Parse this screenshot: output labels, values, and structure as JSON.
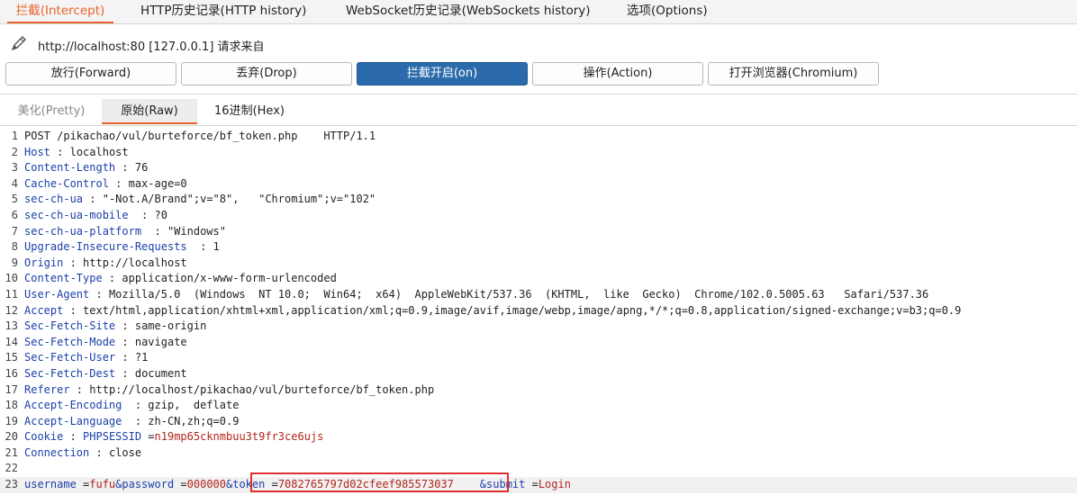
{
  "top_tabs": [
    {
      "label": "拦截(Intercept)",
      "active": true
    },
    {
      "label": "HTTP历史记录(HTTP history)"
    },
    {
      "label": "WebSocket历史记录(WebSockets history)"
    },
    {
      "label": "选项(Options)"
    }
  ],
  "request_info": "http://localhost:80  [127.0.0.1] 请求来自",
  "buttons": {
    "forward": "放行(Forward)",
    "drop": "丢弃(Drop)",
    "intercept": "拦截开启(on)",
    "action": "操作(Action)",
    "browser": "打开浏览器(Chromium)"
  },
  "view_tabs": {
    "pretty": "美化(Pretty)",
    "raw": "原始(Raw)",
    "hex": "16进制(Hex)"
  },
  "request_lines": [
    {
      "n": "1",
      "plain": "POST /pikachao/vul/burteforce/bf_token.php    HTTP/1.1"
    },
    {
      "n": "2",
      "key": "Host",
      "sep": " : ",
      "val": "localhost"
    },
    {
      "n": "3",
      "key": "Content-Length",
      "sep": " : ",
      "val": "76"
    },
    {
      "n": "4",
      "key": "Cache-Control",
      "sep": " : ",
      "val": "max-age=0"
    },
    {
      "n": "5",
      "key": "sec-ch-ua",
      "sep": " : ",
      "val": "\"-Not.A/Brand\";v=\"8\",   \"Chromium\";v=\"102\""
    },
    {
      "n": "6",
      "key": "sec-ch-ua-mobile",
      "sep": "  : ",
      "val": "?0"
    },
    {
      "n": "7",
      "key": "sec-ch-ua-platform",
      "sep": "  : ",
      "val": "\"Windows\""
    },
    {
      "n": "8",
      "key": "Upgrade-Insecure-Requests",
      "sep": "  : ",
      "val": "1"
    },
    {
      "n": "9",
      "key": "Origin",
      "sep": " : ",
      "val": "http://localhost"
    },
    {
      "n": "10",
      "key": "Content-Type",
      "sep": " : ",
      "val": "application/x-www-form-urlencoded"
    },
    {
      "n": "11",
      "key": "User-Agent",
      "sep": " : ",
      "val": "Mozilla/5.0  (Windows  NT 10.0;  Win64;  x64)  AppleWebKit/537.36  (KHTML,  like  Gecko)  Chrome/102.0.5005.63   Safari/537.36"
    },
    {
      "n": "12",
      "key": "Accept",
      "sep": " : ",
      "val": "text/html,application/xhtml+xml,application/xml;q=0.9,image/avif,image/webp,image/apng,*/*;q=0.8,application/signed-exchange;v=b3;q=0.9"
    },
    {
      "n": "13",
      "key": "Sec-Fetch-Site",
      "sep": " : ",
      "val": "same-origin"
    },
    {
      "n": "14",
      "key": "Sec-Fetch-Mode",
      "sep": " : ",
      "val": "navigate"
    },
    {
      "n": "15",
      "key": "Sec-Fetch-User",
      "sep": " : ",
      "val": "?1"
    },
    {
      "n": "16",
      "key": "Sec-Fetch-Dest",
      "sep": " : ",
      "val": "document"
    },
    {
      "n": "17",
      "key": "Referer",
      "sep": " : ",
      "val": "http://localhost/pikachao/vul/burteforce/bf_token.php"
    },
    {
      "n": "18",
      "key": "Accept-Encoding",
      "sep": "  : ",
      "val": "gzip,  deflate"
    },
    {
      "n": "19",
      "key": "Accept-Language",
      "sep": "  : ",
      "val": "zh-CN,zh;q=0.9"
    },
    {
      "n": "20",
      "key": "Cookie",
      "sep": " : ",
      "key2": "PHPSESSID",
      "sep2": " =",
      "val2": "n19mp65cknmbuu3t9fr3ce6ujs"
    },
    {
      "n": "21",
      "key": "Connection",
      "sep": " : ",
      "val": "close"
    },
    {
      "n": "22",
      "plain": ""
    }
  ],
  "body_line": {
    "n": "23",
    "parts": [
      {
        "k": "username",
        "sep": " =",
        "v": "fufu"
      },
      {
        "k": "&password",
        "sep": " =",
        "v": "000000"
      },
      {
        "k": "&token",
        "sep": " =",
        "v": "7082765797d02cfeef985573037"
      },
      {
        "k": "    &submit",
        "sep": " =",
        "v": "Login"
      }
    ]
  },
  "colors": {
    "accent": "#e8632b",
    "primary_button": "#2c6bab",
    "header_key": "#1a3fa8",
    "value_red": "#b3261e",
    "highlight_box": "#e03030"
  }
}
